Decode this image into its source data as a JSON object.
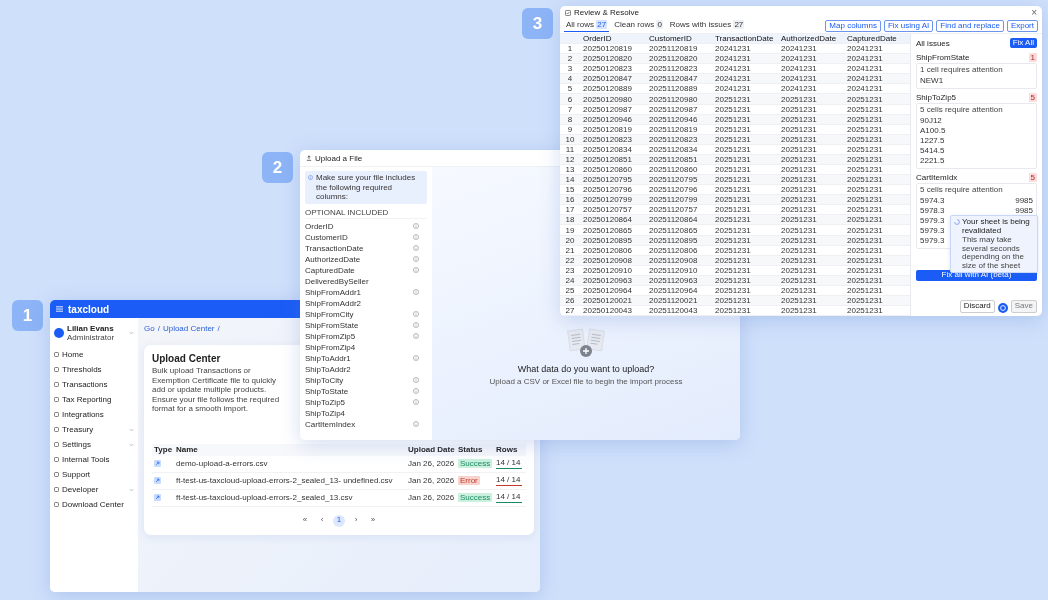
{
  "step_badges": [
    "1",
    "2",
    "3"
  ],
  "app_window": {
    "logo": "taxcloud",
    "user": {
      "name": "Lilian Evans",
      "role": "Administrator"
    },
    "nav": [
      {
        "label": "Home",
        "expandable": false
      },
      {
        "label": "Thresholds",
        "expandable": false
      },
      {
        "label": "Transactions",
        "expandable": false
      },
      {
        "label": "Tax Reporting",
        "expandable": false
      },
      {
        "label": "Integrations",
        "expandable": false
      },
      {
        "label": "Treasury",
        "expandable": true
      },
      {
        "label": "Settings",
        "expandable": true
      },
      {
        "label": "Internal Tools",
        "expandable": false
      },
      {
        "label": "Support",
        "expandable": false
      },
      {
        "label": "Developer",
        "expandable": true
      },
      {
        "label": "Download Center",
        "expandable": false
      }
    ],
    "breadcrumb": {
      "separator": "/",
      "items": [
        "Go",
        "Upload Center"
      ]
    },
    "card": {
      "title": "Upload Center",
      "description": "Bulk upload Transactions or Exemption Certificate file to quickly add or update multiple products. Ensure your file follows the required format for a smooth import.",
      "columns": [
        "Type",
        "Name",
        "Upload Date",
        "Status",
        "Rows"
      ],
      "rows": [
        {
          "name": "demo-upload-a-errors.csv",
          "date": "Jan 26, 2026",
          "status": "Success",
          "kind": "success",
          "rows": "14 / 14",
          "level": 1
        },
        {
          "name": "ft-test-us-taxcloud-upload-errors-2_sealed_13- undefined.csv",
          "date": "Jan 26, 2026",
          "status": "Error",
          "kind": "error",
          "rows": "14 / 14",
          "level": 1
        },
        {
          "name": "ft-test-us-taxcloud-upload-errors-2_sealed_13.csv",
          "date": "Jan 26, 2026",
          "status": "Success",
          "kind": "success",
          "rows": "14 / 14",
          "level": 1
        }
      ],
      "pagination": [
        {
          "label": "«",
          "selected": false
        },
        {
          "label": "‹",
          "selected": false
        },
        {
          "label": "1",
          "selected": true
        },
        {
          "label": "›",
          "selected": false
        },
        {
          "label": "»",
          "selected": false
        }
      ]
    }
  },
  "upload_dialog": {
    "title": "Upload a File",
    "notice": "Make sure your file includes the following required columns:",
    "list_heading": "OPTIONAL INCLUDED",
    "columns": [
      {
        "name": "OrderID",
        "info": true
      },
      {
        "name": "CustomerID",
        "info": true
      },
      {
        "name": "TransactionDate",
        "info": true
      },
      {
        "name": "AuthorizedDate",
        "info": true
      },
      {
        "name": "CapturedDate",
        "info": true
      },
      {
        "name": "DeliveredBySeller",
        "info": false
      },
      {
        "name": "ShipFromAddr1",
        "info": true
      },
      {
        "name": "ShipFromAddr2",
        "info": false
      },
      {
        "name": "ShipFromCity",
        "info": true
      },
      {
        "name": "ShipFromState",
        "info": true
      },
      {
        "name": "ShipFromZip5",
        "info": true
      },
      {
        "name": "ShipFromZip4",
        "info": false
      },
      {
        "name": "ShipToAddr1",
        "info": true
      },
      {
        "name": "ShipToAddr2",
        "info": false
      },
      {
        "name": "ShipToCity",
        "info": true
      },
      {
        "name": "ShipToState",
        "info": true
      },
      {
        "name": "ShipToZip5",
        "info": true
      },
      {
        "name": "ShipToZip4",
        "info": false
      },
      {
        "name": "CartItemIndex",
        "info": true
      }
    ],
    "drop_title": "What data do you want to upload?",
    "drop_hint": "Upload a CSV or Excel file to begin the import process"
  },
  "review_dialog": {
    "title": "Review & Resolve",
    "close": "×",
    "tabs": [
      {
        "label": "All rows",
        "count": "27",
        "selected": true
      },
      {
        "label": "Clean rows",
        "count": "0",
        "selected": false
      },
      {
        "label": "Rows with issues",
        "count": "27",
        "selected": false
      }
    ],
    "actions": [
      "Map columns",
      "Fix using AI",
      "Find and replace",
      "Export"
    ],
    "columns": [
      "",
      "OrderID",
      "CustomerID",
      "TransactionDate",
      "AuthorizedDate",
      "CapturedDate"
    ],
    "rows": [
      [
        "1",
        "20250120819",
        "20251120819",
        "20241231",
        "20241231",
        "20241231"
      ],
      [
        "2",
        "20250120820",
        "20251120820",
        "20241231",
        "20241231",
        "20241231"
      ],
      [
        "3",
        "20250120823",
        "20251120823",
        "20241231",
        "20241231",
        "20241231"
      ],
      [
        "4",
        "20250120847",
        "20251120847",
        "20241231",
        "20241231",
        "20241231"
      ],
      [
        "5",
        "20250120889",
        "20251120889",
        "20241231",
        "20241231",
        "20241231"
      ],
      [
        "6",
        "20250120980",
        "20251120980",
        "20251231",
        "20251231",
        "20251231"
      ],
      [
        "7",
        "20250120987",
        "20251120987",
        "20251231",
        "20251231",
        "20251231"
      ],
      [
        "8",
        "20250120946",
        "20251120946",
        "20251231",
        "20251231",
        "20251231"
      ],
      [
        "9",
        "20250120819",
        "20251120819",
        "20251231",
        "20251231",
        "20251231"
      ],
      [
        "10",
        "20250120823",
        "20251120823",
        "20251231",
        "20251231",
        "20251231"
      ],
      [
        "11",
        "20250120834",
        "20251120834",
        "20251231",
        "20251231",
        "20251231"
      ],
      [
        "12",
        "20250120851",
        "20251120851",
        "20251231",
        "20251231",
        "20251231"
      ],
      [
        "13",
        "20250120860",
        "20251120860",
        "20251231",
        "20251231",
        "20251231"
      ],
      [
        "14",
        "20250120795",
        "20251120795",
        "20251231",
        "20251231",
        "20251231"
      ],
      [
        "15",
        "20250120796",
        "20251120796",
        "20251231",
        "20251231",
        "20251231"
      ],
      [
        "16",
        "20250120799",
        "20251120799",
        "20251231",
        "20251231",
        "20251231"
      ],
      [
        "17",
        "20250120757",
        "20251120757",
        "20251231",
        "20251231",
        "20251231"
      ],
      [
        "18",
        "20250120864",
        "20251120864",
        "20251231",
        "20251231",
        "20251231"
      ],
      [
        "19",
        "20250120865",
        "20251120865",
        "20251231",
        "20251231",
        "20251231"
      ],
      [
        "20",
        "20250120895",
        "20251120895",
        "20251231",
        "20251231",
        "20251231"
      ],
      [
        "21",
        "20250120806",
        "20251120806",
        "20251231",
        "20251231",
        "20251231"
      ],
      [
        "22",
        "20250120908",
        "20251120908",
        "20251231",
        "20251231",
        "20251231"
      ],
      [
        "23",
        "20250120910",
        "20251120910",
        "20251231",
        "20251231",
        "20251231"
      ],
      [
        "24",
        "20250120963",
        "20251120963",
        "20251231",
        "20251231",
        "20251231"
      ],
      [
        "25",
        "20250120964",
        "20251120964",
        "20251231",
        "20251231",
        "20251231"
      ],
      [
        "26",
        "20250120021",
        "20251120021",
        "20251231",
        "20251231",
        "20251231"
      ],
      [
        "27",
        "20250120043",
        "20251120043",
        "20251231",
        "20251231",
        "20251231"
      ]
    ],
    "issues": {
      "title": "All issues",
      "fix_button": "Fix All",
      "groups": [
        {
          "column": "ShipFromState",
          "count": "1",
          "summary": "1 cell requires attention",
          "values": [
            {
              "value": "NEW1"
            }
          ]
        },
        {
          "column": "ShipToZip5",
          "count": "5",
          "summary": "5 cells require attention",
          "values": [
            {
              "value": "90J12"
            },
            {
              "value": "A100.5"
            },
            {
              "value": "1227.5"
            },
            {
              "value": "5414.5"
            },
            {
              "value": "2221.5"
            }
          ]
        },
        {
          "column": "CartItemIdx",
          "count": "5",
          "summary": "5 cells require attention",
          "values": [
            {
              "value": "5974.3",
              "amount": "9985"
            },
            {
              "value": "5978.3",
              "amount": "9985"
            },
            {
              "value": "5979.3"
            },
            {
              "value": "5979.3"
            },
            {
              "value": "5979.3"
            }
          ]
        }
      ],
      "fix_all_button": "Fix all with AI (beta)"
    },
    "toast": {
      "title": "Your sheet is being revalidated",
      "message": "This may take several seconds depending on the size of the sheet"
    },
    "footer": [
      {
        "label": "Discard",
        "disabled": false
      },
      {
        "label": "Save",
        "disabled": true
      }
    ]
  }
}
